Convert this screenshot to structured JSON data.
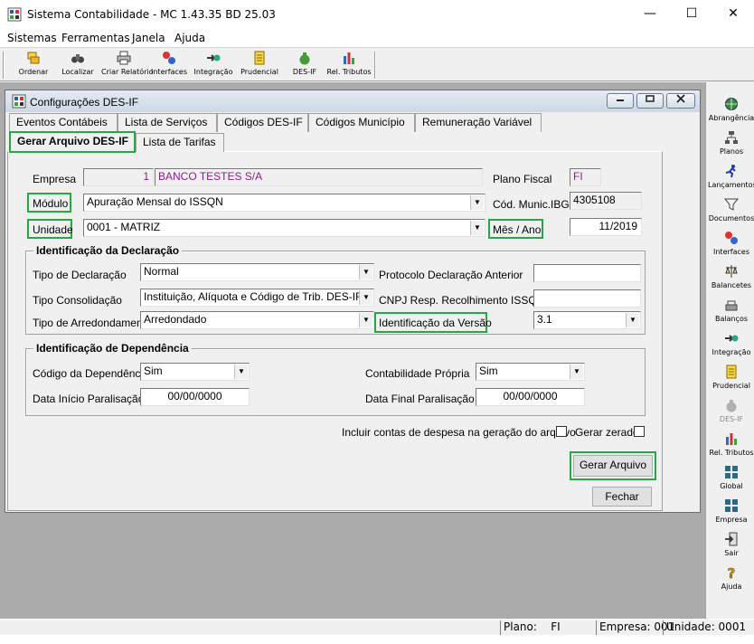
{
  "window": {
    "title": "Sistema Contabilidade -  MC 1.43.35 BD 25.03",
    "minimize_glyph": "—",
    "maximize_glyph": "☐",
    "close_glyph": "✕"
  },
  "menu": [
    "Sistemas",
    "Ferramentas",
    "Janela",
    "Ajuda"
  ],
  "toolbar": [
    {
      "label": "Ordenar",
      "icon": "sort-icon"
    },
    {
      "label": "Localizar",
      "icon": "binoculars-icon"
    },
    {
      "label": "Criar Relatório",
      "icon": "printer-icon"
    },
    {
      "label": "Interfaces",
      "icon": "interfaces-icon"
    },
    {
      "label": "Integração",
      "icon": "integration-icon"
    },
    {
      "label": "Prudencial",
      "icon": "document-icon"
    },
    {
      "label": "DES-IF",
      "icon": "money-bag-icon"
    },
    {
      "label": "Rel. Tributos",
      "icon": "bar-chart-icon"
    }
  ],
  "rightbar": [
    {
      "label": "Abrangência",
      "icon": "globe-icon"
    },
    {
      "label": "Planos",
      "icon": "tree-icon"
    },
    {
      "label": "Lançamentos",
      "icon": "runner-icon"
    },
    {
      "label": "Documentos",
      "icon": "funnel-icon"
    },
    {
      "label": "Interfaces",
      "icon": "interfaces-icon"
    },
    {
      "label": "Balancetes",
      "icon": "balance-icon"
    },
    {
      "label": "Balanços",
      "icon": "scale-icon"
    },
    {
      "label": "Integração",
      "icon": "integration-icon"
    },
    {
      "label": "Prudencial",
      "icon": "document-icon"
    },
    {
      "label": "DES-IF",
      "icon": "money-bag-icon"
    },
    {
      "label": "Rel. Tributos",
      "icon": "bar-chart-icon"
    },
    {
      "label": "Global",
      "icon": "grid-icon"
    },
    {
      "label": "Empresa",
      "icon": "grid-icon"
    },
    {
      "label": "Sair",
      "icon": "exit-icon"
    },
    {
      "label": "Ajuda",
      "icon": "help-icon"
    }
  ],
  "dialog": {
    "title": "Configurações DES-IF",
    "tabs_row1": [
      "Eventos Contábeis",
      "Lista de Serviços",
      "Códigos DES-IF",
      "Códigos Município",
      "Remuneração Variável"
    ],
    "tabs_row2": [
      "Gerar Arquivo DES-IF",
      "Lista de Tarifas"
    ],
    "form": {
      "empresa_label": "Empresa",
      "empresa_code": "1",
      "empresa_name": "BANCO TESTES S/A",
      "plano_fiscal_label": "Plano Fiscal",
      "plano_fiscal_value": "FI",
      "modulo_label": "Módulo",
      "modulo_value": "Apuração Mensal do ISSQN",
      "cod_munic_label": "Cód. Munic.IBGE",
      "cod_munic_value": "4305108",
      "unidade_label": "Unidade",
      "unidade_value": "0001 - MATRIZ",
      "mes_ano_label": "Mês / Ano",
      "mes_ano_value": "11/2019"
    },
    "declaracao": {
      "group_title": "Identificação da Declaração",
      "tipo_declaracao_label": "Tipo de Declaração",
      "tipo_declaracao_value": "Normal",
      "protocolo_label": "Protocolo Declaração Anterior",
      "protocolo_value": "",
      "tipo_consolidacao_label": "Tipo Consolidação",
      "tipo_consolidacao_value": "Instituição, Alíquota e Código de Trib. DES-IF",
      "cnpj_label": "CNPJ Resp. Recolhimento ISSQN",
      "cnpj_value": "",
      "tipo_arredondamento_label": "Tipo de Arredondamento",
      "tipo_arredondamento_value": "Arredondado",
      "versao_label": "Identificação da Versão",
      "versao_value": "3.1"
    },
    "dependencia": {
      "group_title": "Identificação de Dependência",
      "codigo_label": "Código da Dependência",
      "codigo_value": "Sim",
      "contabilidade_label": "Contabilidade Própria",
      "contabilidade_value": "Sim",
      "data_inicio_label": "Data Início Paralisação",
      "data_inicio_value": "00/00/0000",
      "data_final_label": "Data Final Paralisação",
      "data_final_value": "00/00/0000"
    },
    "incluir_contas_label": "Incluir contas de despesa na geração do arquivo",
    "gerar_zerado_label": "Gerar zerado",
    "gerar_button": "Gerar Arquivo",
    "fechar_button": "Fechar"
  },
  "statusbar": {
    "plano_label": "Plano:",
    "plano_value": "FI",
    "empresa": "Empresa: 001",
    "unidade": "Unidade: 0001"
  },
  "colors": {
    "highlight": "#28a745",
    "purple_text": "#8a1f8a",
    "mdi_background": "#ababab"
  }
}
